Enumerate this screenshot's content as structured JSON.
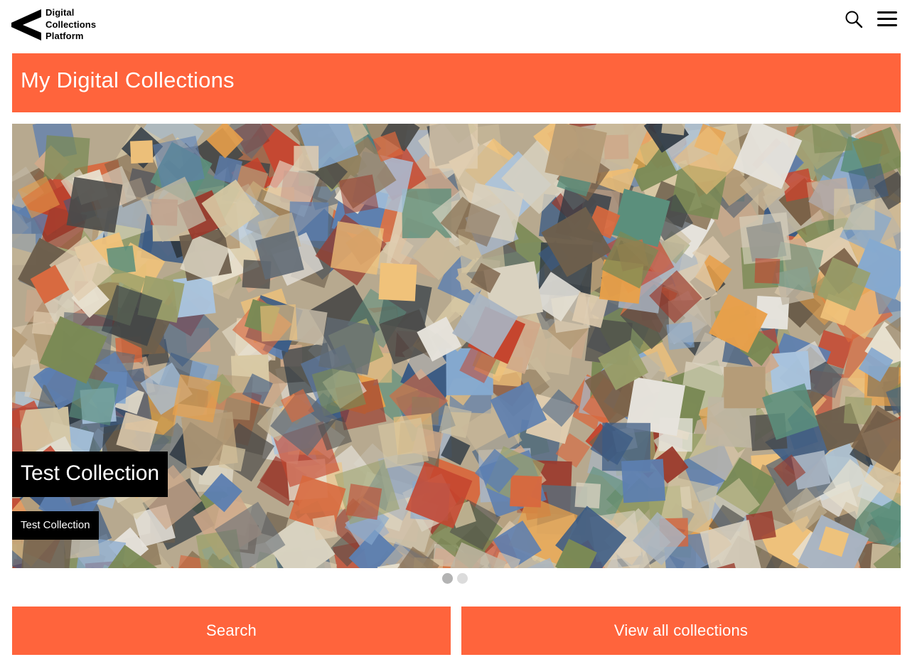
{
  "colors": {
    "accent": "#ff643c",
    "text_on_accent": "#ffffff",
    "caption_bg": "#000000",
    "dot_active": "#b3b3b3",
    "dot_inactive": "#dcdcdc"
  },
  "header": {
    "logo_lines": [
      "Digital",
      "Collections",
      "Platform"
    ],
    "icons": [
      "search-icon",
      "menu-icon"
    ]
  },
  "page": {
    "title": "My Digital Collections"
  },
  "carousel": {
    "slides_count": 2,
    "active_index": 0,
    "slide": {
      "title": "Test Collection",
      "subtitle": "Test Collection"
    }
  },
  "actions": {
    "search_label": "Search",
    "view_all_label": "View all collections"
  }
}
